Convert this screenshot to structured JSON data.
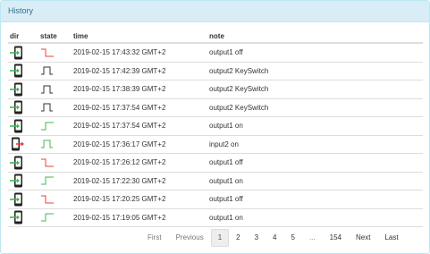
{
  "panel": {
    "title": "History"
  },
  "table": {
    "headers": {
      "dir": "dir",
      "state": "state",
      "time": "time",
      "note": "note"
    },
    "rows": [
      {
        "dir": "in",
        "state": "falling-red",
        "time": "2019-02-15 17:43:32 GMT+2",
        "note": "output1 off"
      },
      {
        "dir": "in",
        "state": "pulse-black",
        "time": "2019-02-15 17:42:39 GMT+2",
        "note": "output2 KeySwitch"
      },
      {
        "dir": "in",
        "state": "pulse-black",
        "time": "2019-02-15 17:38:39 GMT+2",
        "note": "output2 KeySwitch"
      },
      {
        "dir": "in",
        "state": "pulse-black",
        "time": "2019-02-15 17:37:54 GMT+2",
        "note": "output2 KeySwitch"
      },
      {
        "dir": "in",
        "state": "rising-green",
        "time": "2019-02-15 17:37:54 GMT+2",
        "note": "output1 on"
      },
      {
        "dir": "out",
        "state": "pulse-green",
        "time": "2019-02-15 17:36:17 GMT+2",
        "note": "input2 on"
      },
      {
        "dir": "in",
        "state": "falling-red",
        "time": "2019-02-15 17:26:12 GMT+2",
        "note": "output1 off"
      },
      {
        "dir": "in",
        "state": "rising-green",
        "time": "2019-02-15 17:22:30 GMT+2",
        "note": "output1 on"
      },
      {
        "dir": "in",
        "state": "falling-red",
        "time": "2019-02-15 17:20:25 GMT+2",
        "note": "output1 off"
      },
      {
        "dir": "in",
        "state": "rising-green",
        "time": "2019-02-15 17:19:05 GMT+2",
        "note": "output1 on"
      }
    ]
  },
  "pagination": {
    "first": "First",
    "previous": "Previous",
    "pages": [
      "1",
      "2",
      "3",
      "4",
      "5"
    ],
    "active_page": "1",
    "ellipsis": "...",
    "last_page": "154",
    "next": "Next",
    "last": "Last"
  },
  "colors": {
    "heading_bg": "#d9edf7",
    "heading_text": "#31708f",
    "state_red": "#e8403c",
    "state_green": "#3cba54",
    "state_black": "#333333",
    "arrow_red": "#e8403c",
    "arrow_green": "#3cba54"
  }
}
